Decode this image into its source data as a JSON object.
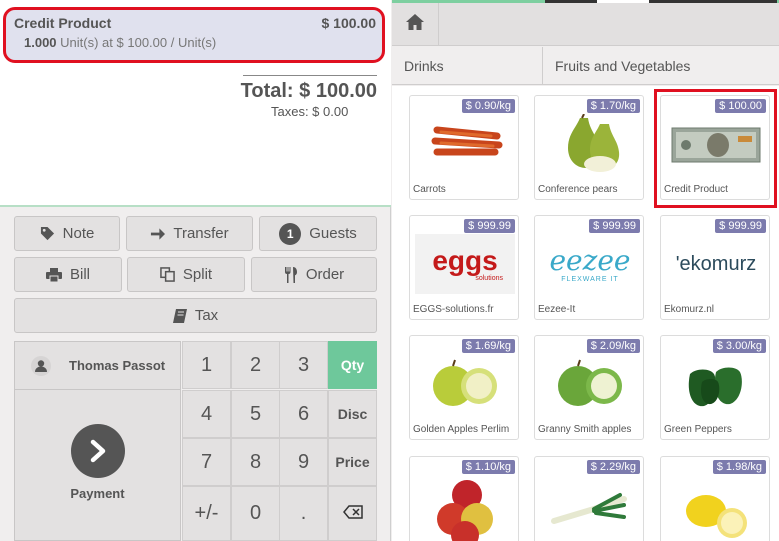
{
  "order": {
    "line": {
      "product": "Credit Product",
      "price": "$ 100.00",
      "qty": "1.000",
      "unit_info": "Unit(s) at $ 100.00 / Unit(s)"
    },
    "total_label": "Total: $ 100.00",
    "taxes_label": "Taxes: $ 0.00"
  },
  "control_buttons": {
    "note": "Note",
    "transfer": "Transfer",
    "guests_count": "1",
    "guests": "Guests",
    "bill": "Bill",
    "split": "Split",
    "order": "Order",
    "tax": "Tax"
  },
  "customer": {
    "name": "Thomas Passot"
  },
  "payment": {
    "label": "Payment"
  },
  "numpad": {
    "keys": [
      "1",
      "2",
      "3",
      "4",
      "5",
      "6",
      "7",
      "8",
      "9",
      "+/-",
      "0",
      "."
    ],
    "modes": [
      "Qty",
      "Disc",
      "Price"
    ],
    "active_mode": "Qty"
  },
  "categories": [
    "Drinks",
    "Fruits and Vegetables"
  ],
  "products": [
    {
      "name": "Carrots",
      "price": "$ 0.90/kg"
    },
    {
      "name": "Conference pears",
      "price": "$ 1.70/kg"
    },
    {
      "name": "Credit Product",
      "price": "$ 100.00"
    },
    {
      "name": "EGGS-solutions.fr",
      "price": "$ 999.99"
    },
    {
      "name": "Eezee-It",
      "price": "$ 999.99"
    },
    {
      "name": "Ekomurz.nl",
      "price": "$ 999.99"
    },
    {
      "name": "Golden Apples Perlim",
      "price": "$ 1.69/kg"
    },
    {
      "name": "Granny Smith apples",
      "price": "$ 2.09/kg"
    },
    {
      "name": "Green Peppers",
      "price": "$ 3.00/kg"
    },
    {
      "name": "",
      "price": "$ 1.10/kg"
    },
    {
      "name": "",
      "price": "$ 2.29/kg"
    },
    {
      "name": "",
      "price": "$ 1.98/kg"
    }
  ],
  "logos": {
    "eggs": "eggs",
    "eggs_sub": "solutions",
    "eezee": "eezee",
    "eezee_sub": "FLEXWARE IT",
    "ekomurz": "'ekomurz"
  },
  "colors": {
    "accent_green": "#6ec89b",
    "price_tag": "#7c7bad",
    "highlight_red": "#e01020",
    "selected_line": "#e0e1ee"
  }
}
